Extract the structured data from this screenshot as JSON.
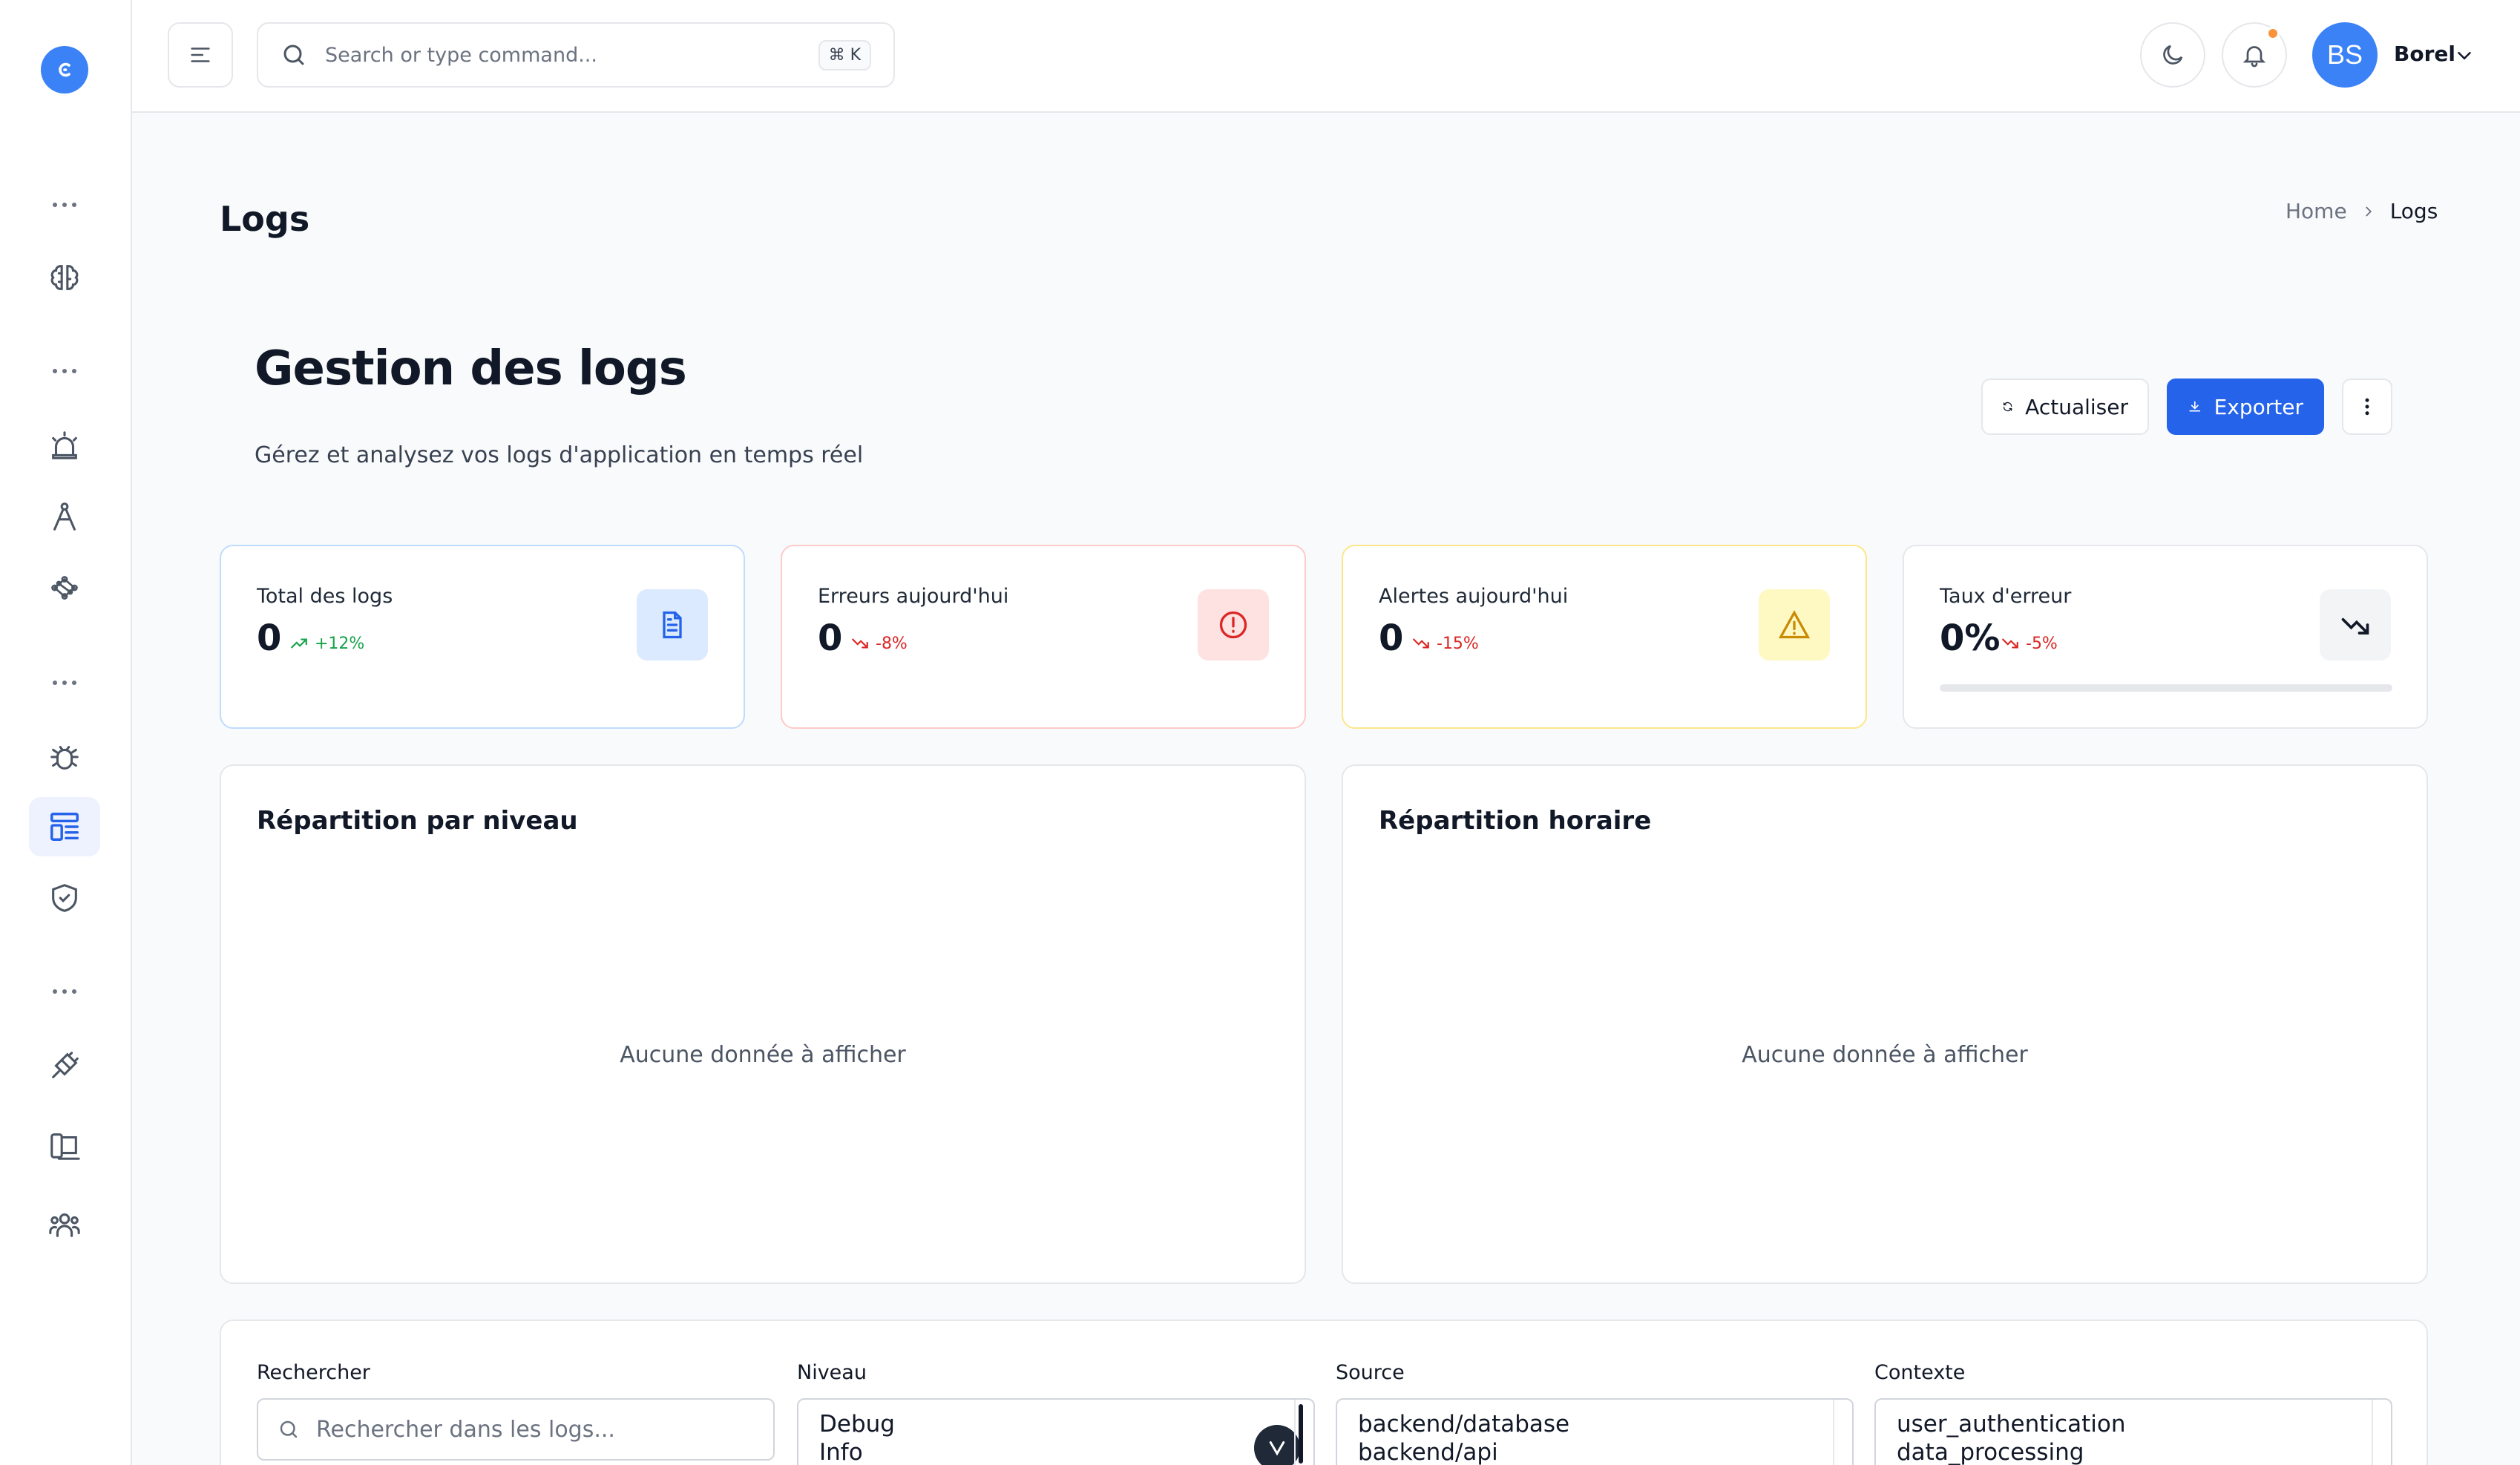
{
  "header": {
    "search_placeholder": "Search or type command...",
    "shortcut": "⌘ K",
    "user_initials": "BS",
    "user_name": "Borel"
  },
  "page": {
    "title": "Logs",
    "breadcrumb": {
      "home": "Home",
      "current": "Logs"
    }
  },
  "section": {
    "title": "Gestion des logs",
    "subtitle": "Gérez et analysez vos logs d'application en temps réel",
    "refresh_label": "Actualiser",
    "export_label": "Exporter"
  },
  "stats": [
    {
      "label": "Total des logs",
      "value": "0",
      "change": "+12%",
      "trend": "up",
      "icon": "file-text-icon",
      "color": "#2563eb",
      "bg": "#dbeafe",
      "border": "#bfdbfe"
    },
    {
      "label": "Erreurs aujourd'hui",
      "value": "0",
      "change": "-8%",
      "trend": "down",
      "icon": "alert-circle-icon",
      "color": "#dc2626",
      "bg": "#fee2e2",
      "border": "#fecaca"
    },
    {
      "label": "Alertes aujourd'hui",
      "value": "0",
      "change": "-15%",
      "trend": "down",
      "icon": "alert-triangle-icon",
      "color": "#ca8a04",
      "bg": "#fef9c3",
      "border": "#fde68a"
    },
    {
      "label": "Taux d'erreur",
      "value": "0%",
      "change": "-5%",
      "trend": "down",
      "icon": "trending-down-icon",
      "color": "#111827",
      "bg": "#f3f4f6",
      "border": "#e5e7eb",
      "progress": 0
    }
  ],
  "charts": {
    "by_level": {
      "title": "Répartition par niveau",
      "empty": "Aucune donnée à afficher"
    },
    "hourly": {
      "title": "Répartition horaire",
      "empty": "Aucune donnée à afficher"
    }
  },
  "filters": {
    "search_label": "Rechercher",
    "search_placeholder": "Rechercher dans les logs...",
    "level_label": "Niveau",
    "level_options": [
      "Debug",
      "Info"
    ],
    "source_label": "Source",
    "source_options": [
      "backend/database",
      "backend/api"
    ],
    "context_label": "Contexte",
    "context_options": [
      "user_authentication",
      "data_processing"
    ]
  },
  "colors": {
    "accent": "#2563eb",
    "positive": "#16a34a",
    "negative": "#dc2626"
  }
}
